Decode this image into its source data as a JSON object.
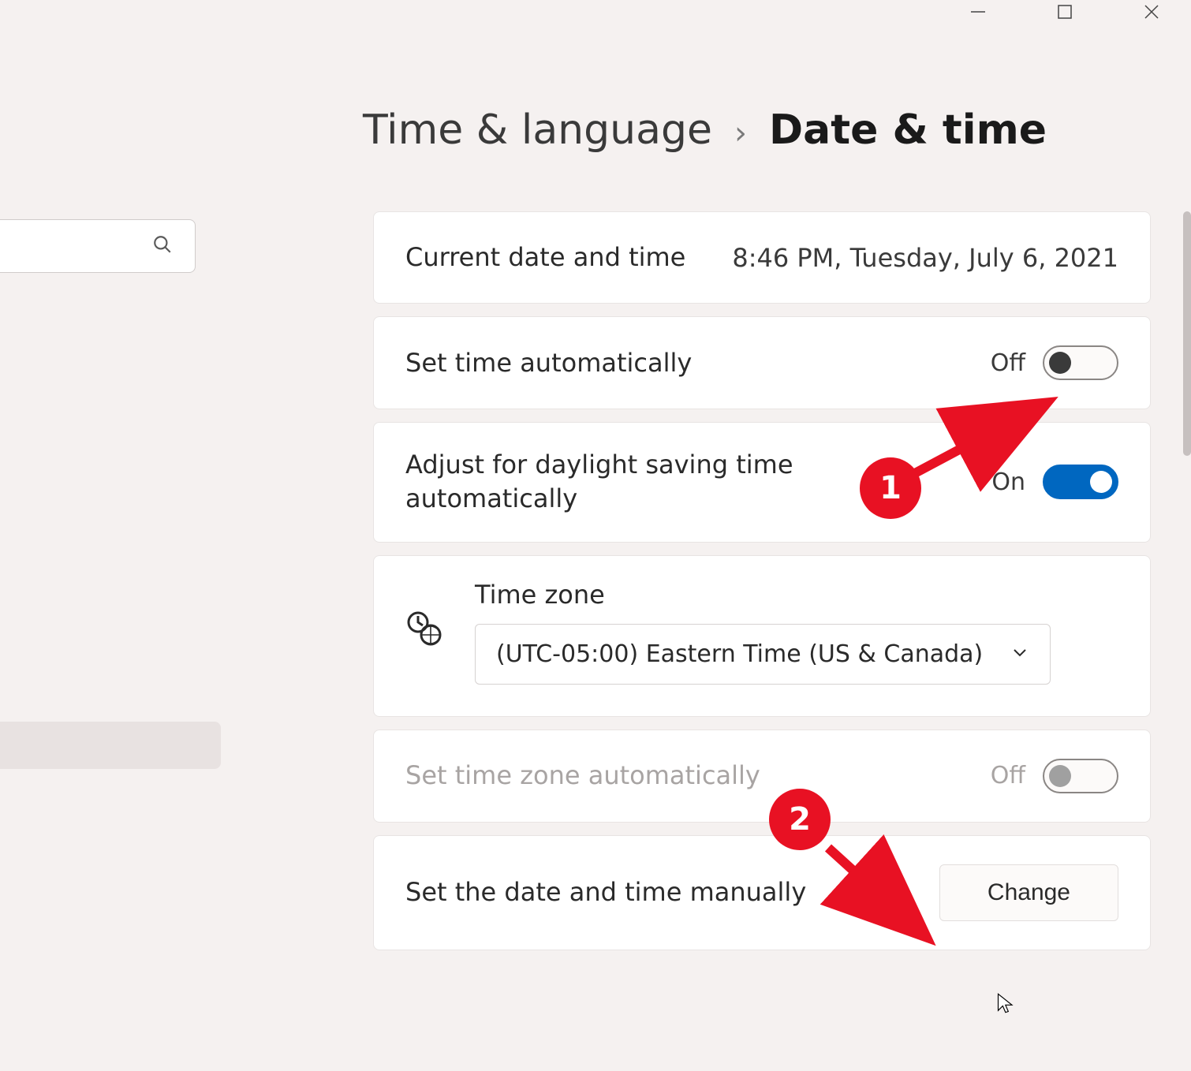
{
  "breadcrumb": {
    "parent": "Time & language",
    "current": "Date & time"
  },
  "currentDateTime": {
    "label": "Current date and time",
    "value": "8:46 PM, Tuesday, July 6, 2021"
  },
  "setTimeAuto": {
    "label": "Set time automatically",
    "state": "Off"
  },
  "dstAuto": {
    "label": "Adjust for daylight saving time automatically",
    "state": "On"
  },
  "timeZone": {
    "label": "Time zone",
    "value": "(UTC-05:00) Eastern Time (US & Canada)"
  },
  "setTzAuto": {
    "label": "Set time zone automatically",
    "state": "Off"
  },
  "manual": {
    "label": "Set the date and time manually",
    "button": "Change"
  },
  "annotations": {
    "step1": "1",
    "step2": "2"
  }
}
